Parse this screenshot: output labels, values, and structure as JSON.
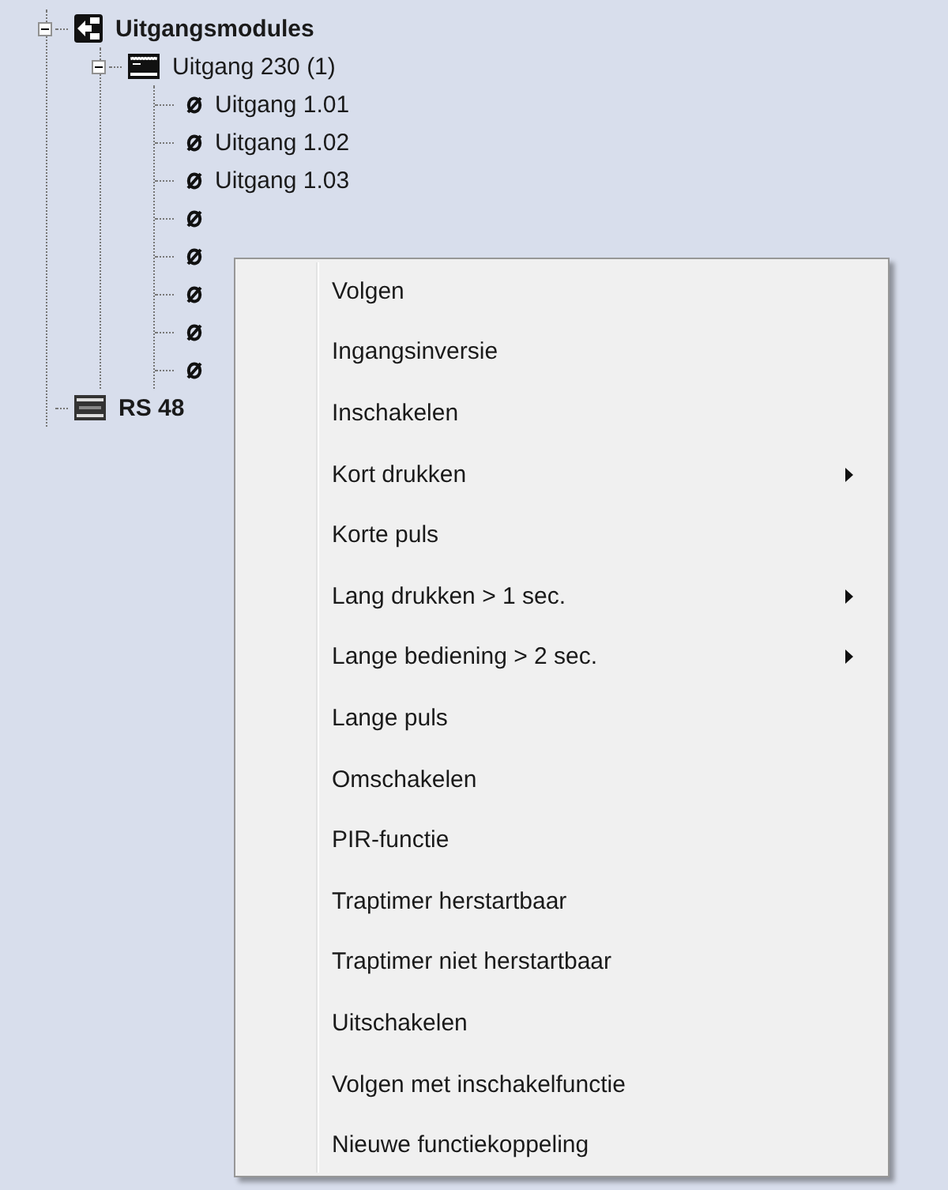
{
  "tree": [
    {
      "kind": "module-group",
      "label": "Uitgangsmodules",
      "expanded": true,
      "children": [
        {
          "kind": "module",
          "label": "Uitgang 230 (1)",
          "expanded": true,
          "children": [
            {
              "kind": "output",
              "label": "Uitgang 1.01"
            },
            {
              "kind": "output",
              "label": "Uitgang 1.02"
            },
            {
              "kind": "output",
              "label": "Uitgang 1.03"
            },
            {
              "kind": "output"
            },
            {
              "kind": "output"
            },
            {
              "kind": "output"
            },
            {
              "kind": "output"
            },
            {
              "kind": "output"
            }
          ]
        }
      ]
    },
    {
      "kind": "bus",
      "label": "RS 48"
    }
  ],
  "context_menu": {
    "items": [
      {
        "label": "Volgen",
        "submenu": false
      },
      {
        "label": "Ingangsinversie",
        "submenu": false
      },
      {
        "label": "Inschakelen",
        "submenu": false
      },
      {
        "label": "Kort drukken",
        "submenu": true
      },
      {
        "label": "Korte puls",
        "submenu": false
      },
      {
        "label": "Lang drukken > 1 sec.",
        "submenu": true
      },
      {
        "label": "Lange bediening > 2 sec.",
        "submenu": true
      },
      {
        "label": "Lange puls",
        "submenu": false
      },
      {
        "label": "Omschakelen",
        "submenu": false
      },
      {
        "label": "PIR-functie",
        "submenu": false
      },
      {
        "label": "Traptimer herstartbaar",
        "submenu": false
      },
      {
        "label": "Traptimer niet herstartbaar",
        "submenu": false
      },
      {
        "label": "Uitschakelen",
        "submenu": false
      },
      {
        "label": "Volgen met inschakelfunctie",
        "submenu": false
      },
      {
        "label": "Nieuwe functiekoppeling",
        "submenu": false
      }
    ]
  }
}
